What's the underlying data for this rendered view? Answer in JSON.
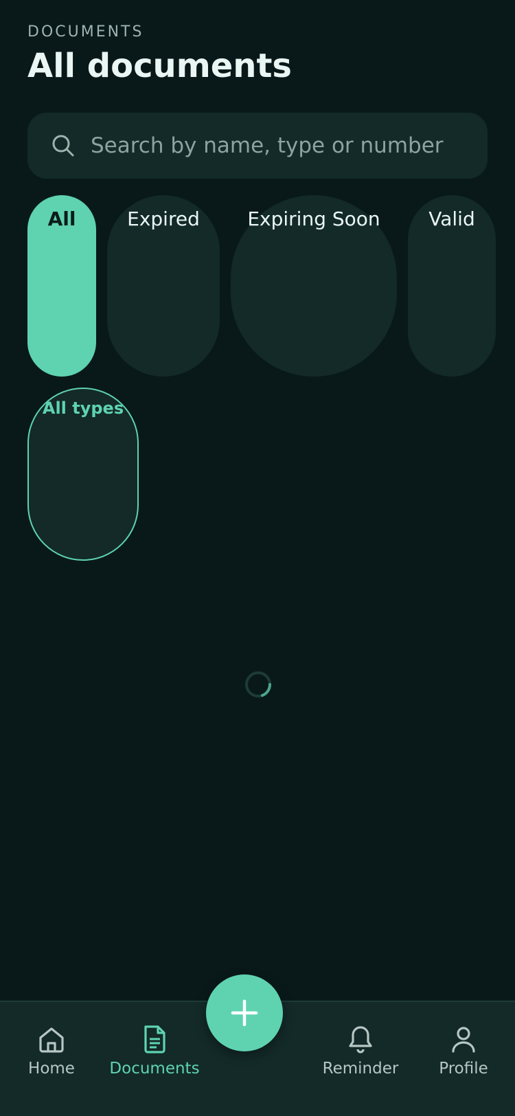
{
  "header": {
    "eyebrow": "DOCUMENTS",
    "title": "All documents"
  },
  "search": {
    "placeholder": "Search by name, type or number",
    "icon": "search-icon"
  },
  "status_filters": [
    {
      "label": "All",
      "selected": true
    },
    {
      "label": "Expired",
      "selected": false
    },
    {
      "label": "Expiring Soon",
      "selected": false
    },
    {
      "label": "Valid",
      "selected": false
    }
  ],
  "type_filter": {
    "label": "All types",
    "selected": true
  },
  "loading": true,
  "fab": {
    "icon": "plus-icon"
  },
  "tabbar": {
    "items": [
      {
        "label": "Home",
        "icon": "home-icon",
        "active": false
      },
      {
        "label": "Documents",
        "icon": "document-icon",
        "active": true
      },
      {
        "label": "Reminder",
        "icon": "bell-icon",
        "active": false
      },
      {
        "label": "Profile",
        "icon": "user-icon",
        "active": false
      }
    ]
  },
  "colors": {
    "background": "#09191a",
    "surface": "#132a28",
    "accent": "#5fd3b0",
    "muted_text": "#9fb3ae"
  }
}
